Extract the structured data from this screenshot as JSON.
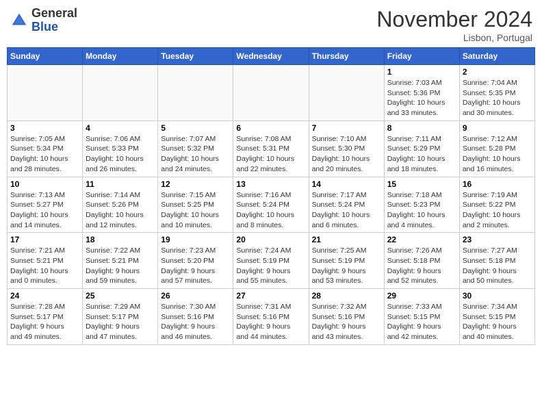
{
  "header": {
    "logo_line1": "General",
    "logo_line2": "Blue",
    "month": "November 2024",
    "location": "Lisbon, Portugal"
  },
  "weekdays": [
    "Sunday",
    "Monday",
    "Tuesday",
    "Wednesday",
    "Thursday",
    "Friday",
    "Saturday"
  ],
  "weeks": [
    [
      {
        "day": "",
        "info": ""
      },
      {
        "day": "",
        "info": ""
      },
      {
        "day": "",
        "info": ""
      },
      {
        "day": "",
        "info": ""
      },
      {
        "day": "",
        "info": ""
      },
      {
        "day": "1",
        "info": "Sunrise: 7:03 AM\nSunset: 5:36 PM\nDaylight: 10 hours\nand 33 minutes."
      },
      {
        "day": "2",
        "info": "Sunrise: 7:04 AM\nSunset: 5:35 PM\nDaylight: 10 hours\nand 30 minutes."
      }
    ],
    [
      {
        "day": "3",
        "info": "Sunrise: 7:05 AM\nSunset: 5:34 PM\nDaylight: 10 hours\nand 28 minutes."
      },
      {
        "day": "4",
        "info": "Sunrise: 7:06 AM\nSunset: 5:33 PM\nDaylight: 10 hours\nand 26 minutes."
      },
      {
        "day": "5",
        "info": "Sunrise: 7:07 AM\nSunset: 5:32 PM\nDaylight: 10 hours\nand 24 minutes."
      },
      {
        "day": "6",
        "info": "Sunrise: 7:08 AM\nSunset: 5:31 PM\nDaylight: 10 hours\nand 22 minutes."
      },
      {
        "day": "7",
        "info": "Sunrise: 7:10 AM\nSunset: 5:30 PM\nDaylight: 10 hours\nand 20 minutes."
      },
      {
        "day": "8",
        "info": "Sunrise: 7:11 AM\nSunset: 5:29 PM\nDaylight: 10 hours\nand 18 minutes."
      },
      {
        "day": "9",
        "info": "Sunrise: 7:12 AM\nSunset: 5:28 PM\nDaylight: 10 hours\nand 16 minutes."
      }
    ],
    [
      {
        "day": "10",
        "info": "Sunrise: 7:13 AM\nSunset: 5:27 PM\nDaylight: 10 hours\nand 14 minutes."
      },
      {
        "day": "11",
        "info": "Sunrise: 7:14 AM\nSunset: 5:26 PM\nDaylight: 10 hours\nand 12 minutes."
      },
      {
        "day": "12",
        "info": "Sunrise: 7:15 AM\nSunset: 5:25 PM\nDaylight: 10 hours\nand 10 minutes."
      },
      {
        "day": "13",
        "info": "Sunrise: 7:16 AM\nSunset: 5:24 PM\nDaylight: 10 hours\nand 8 minutes."
      },
      {
        "day": "14",
        "info": "Sunrise: 7:17 AM\nSunset: 5:24 PM\nDaylight: 10 hours\nand 6 minutes."
      },
      {
        "day": "15",
        "info": "Sunrise: 7:18 AM\nSunset: 5:23 PM\nDaylight: 10 hours\nand 4 minutes."
      },
      {
        "day": "16",
        "info": "Sunrise: 7:19 AM\nSunset: 5:22 PM\nDaylight: 10 hours\nand 2 minutes."
      }
    ],
    [
      {
        "day": "17",
        "info": "Sunrise: 7:21 AM\nSunset: 5:21 PM\nDaylight: 10 hours\nand 0 minutes."
      },
      {
        "day": "18",
        "info": "Sunrise: 7:22 AM\nSunset: 5:21 PM\nDaylight: 9 hours\nand 59 minutes."
      },
      {
        "day": "19",
        "info": "Sunrise: 7:23 AM\nSunset: 5:20 PM\nDaylight: 9 hours\nand 57 minutes."
      },
      {
        "day": "20",
        "info": "Sunrise: 7:24 AM\nSunset: 5:19 PM\nDaylight: 9 hours\nand 55 minutes."
      },
      {
        "day": "21",
        "info": "Sunrise: 7:25 AM\nSunset: 5:19 PM\nDaylight: 9 hours\nand 53 minutes."
      },
      {
        "day": "22",
        "info": "Sunrise: 7:26 AM\nSunset: 5:18 PM\nDaylight: 9 hours\nand 52 minutes."
      },
      {
        "day": "23",
        "info": "Sunrise: 7:27 AM\nSunset: 5:18 PM\nDaylight: 9 hours\nand 50 minutes."
      }
    ],
    [
      {
        "day": "24",
        "info": "Sunrise: 7:28 AM\nSunset: 5:17 PM\nDaylight: 9 hours\nand 49 minutes."
      },
      {
        "day": "25",
        "info": "Sunrise: 7:29 AM\nSunset: 5:17 PM\nDaylight: 9 hours\nand 47 minutes."
      },
      {
        "day": "26",
        "info": "Sunrise: 7:30 AM\nSunset: 5:16 PM\nDaylight: 9 hours\nand 46 minutes."
      },
      {
        "day": "27",
        "info": "Sunrise: 7:31 AM\nSunset: 5:16 PM\nDaylight: 9 hours\nand 44 minutes."
      },
      {
        "day": "28",
        "info": "Sunrise: 7:32 AM\nSunset: 5:16 PM\nDaylight: 9 hours\nand 43 minutes."
      },
      {
        "day": "29",
        "info": "Sunrise: 7:33 AM\nSunset: 5:15 PM\nDaylight: 9 hours\nand 42 minutes."
      },
      {
        "day": "30",
        "info": "Sunrise: 7:34 AM\nSunset: 5:15 PM\nDaylight: 9 hours\nand 40 minutes."
      }
    ]
  ]
}
